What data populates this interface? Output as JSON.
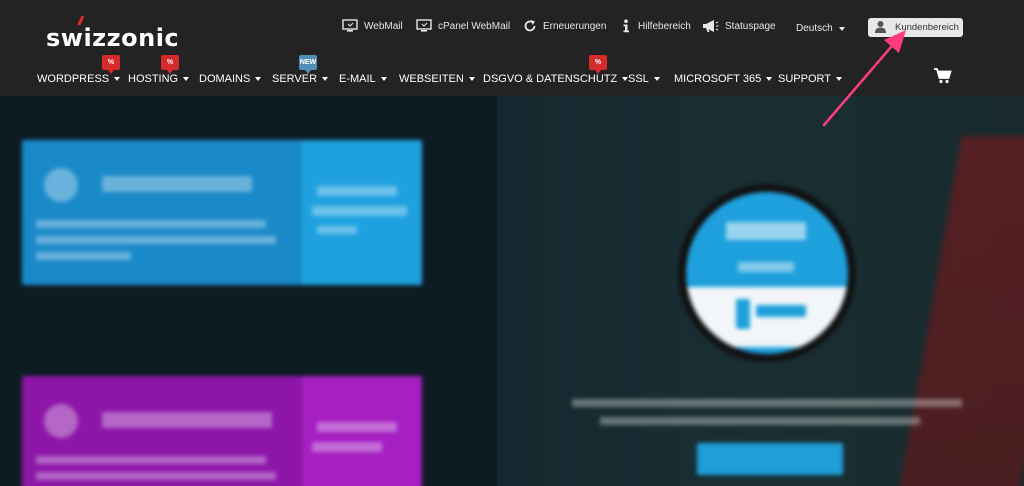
{
  "brand": {
    "logo_text": "swizzonic",
    "accent_color": "#e32b2b"
  },
  "top_links": [
    {
      "label": "WebMail",
      "icon": "monitor-icon"
    },
    {
      "label": "cPanel WebMail",
      "icon": "monitor-icon"
    },
    {
      "label": "Erneuerungen",
      "icon": "refresh-icon"
    },
    {
      "label": "Hilfebereich",
      "icon": "info-icon"
    },
    {
      "label": "Statuspage",
      "icon": "megaphone-icon"
    }
  ],
  "language": {
    "selected": "Deutsch"
  },
  "account_button": {
    "label": "Kundenbereich",
    "icon": "user-icon"
  },
  "nav": [
    {
      "label": "WORDPRESS",
      "badge": "%"
    },
    {
      "label": "HOSTING",
      "badge": "%"
    },
    {
      "label": "DOMAINS"
    },
    {
      "label": "SERVER",
      "badge": "NEW"
    },
    {
      "label": "E-MAIL"
    },
    {
      "label": "WEBSEITEN"
    },
    {
      "label": "DSGVO & DATENSCHUTZ",
      "badge": "%"
    },
    {
      "label": "SSL"
    },
    {
      "label": "MICROSOFT 365"
    },
    {
      "label": "SUPPORT"
    }
  ],
  "cart": {
    "icon": "cart-icon"
  },
  "colors": {
    "header_bg": "#232323",
    "badge_red": "#d52b2b",
    "badge_blue": "#4f8fb5",
    "annotation_arrow": "#ff3c7a",
    "card_blue": "#1989c8",
    "card_purple": "#8d16a8"
  }
}
